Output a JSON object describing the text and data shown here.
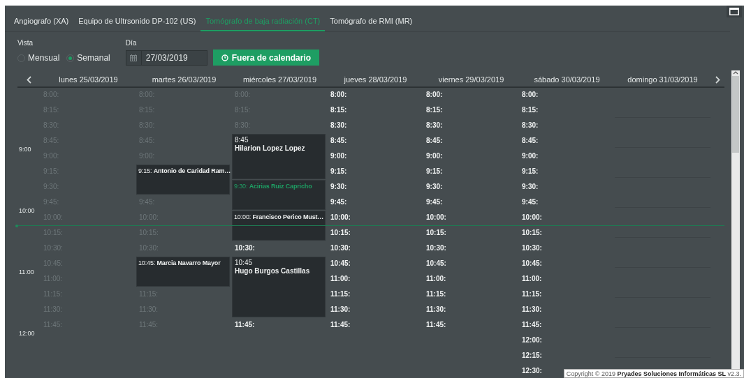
{
  "tabs": [
    {
      "label": "Angiografo (XA)",
      "selected": false
    },
    {
      "label": "Equipo de Ultrsonido DP-102 (US)",
      "selected": false
    },
    {
      "label": "Tomógrafo de baja radiación (CT)",
      "selected": true
    },
    {
      "label": "Tomógrafo de RMI (MR)",
      "selected": false
    }
  ],
  "view": {
    "label": "Vista",
    "options": [
      {
        "label": "Mensual",
        "selected": false
      },
      {
        "label": "Semanal",
        "selected": true
      }
    ]
  },
  "date": {
    "label": "Día",
    "value": "27/03/2019"
  },
  "out_of_calendar_button": {
    "label": "Fuera de calendario"
  },
  "hours": [
    "9:00",
    "10:00",
    "11:00",
    "12:00"
  ],
  "days": [
    {
      "header": "lunes 25/03/2019",
      "items": [
        {
          "kind": "slot",
          "time": "8:00:",
          "past": true
        },
        {
          "kind": "slot",
          "time": "8:15:",
          "past": true
        },
        {
          "kind": "slot",
          "time": "8:30:",
          "past": true
        },
        {
          "kind": "slot",
          "time": "8:45:",
          "past": true
        },
        {
          "kind": "slot",
          "time": "9:00:",
          "past": true
        },
        {
          "kind": "slot",
          "time": "9:15:",
          "past": true
        },
        {
          "kind": "slot",
          "time": "9:30:",
          "past": true
        },
        {
          "kind": "slot",
          "time": "9:45:",
          "past": true
        },
        {
          "kind": "slot",
          "time": "10:00:",
          "past": true
        },
        {
          "kind": "slot",
          "time": "10:15:",
          "past": true
        },
        {
          "kind": "slot",
          "time": "10:30:",
          "past": true
        },
        {
          "kind": "slot",
          "time": "10:45:",
          "past": true
        },
        {
          "kind": "slot",
          "time": "11:00:",
          "past": true
        },
        {
          "kind": "slot",
          "time": "11:15:",
          "past": true
        },
        {
          "kind": "slot",
          "time": "11:30:",
          "past": true
        },
        {
          "kind": "slot",
          "time": "11:45:",
          "past": true
        }
      ]
    },
    {
      "header": "martes 26/03/2019",
      "items": [
        {
          "kind": "slot",
          "time": "8:00:",
          "past": true
        },
        {
          "kind": "slot",
          "time": "8:15:",
          "past": true
        },
        {
          "kind": "slot",
          "time": "8:30:",
          "past": true
        },
        {
          "kind": "slot",
          "time": "8:45:",
          "past": true
        },
        {
          "kind": "slot",
          "time": "9:00:",
          "past": true
        },
        {
          "kind": "inline-event",
          "time": "9:15:",
          "name": "Antonio de Caridad Ram…",
          "highlighted": false
        },
        {
          "kind": "slot",
          "time": "9:45:",
          "past": true
        },
        {
          "kind": "slot",
          "time": "10:00:",
          "past": true
        },
        {
          "kind": "slot",
          "time": "10:15:",
          "past": true
        },
        {
          "kind": "slot",
          "time": "10:30:",
          "past": true
        },
        {
          "kind": "inline-event",
          "time": "10:45:",
          "name": "Marcia Navarro Mayor",
          "highlighted": false
        },
        {
          "kind": "slot",
          "time": "11:15:",
          "past": true
        },
        {
          "kind": "slot",
          "time": "11:30:",
          "past": true
        },
        {
          "kind": "slot",
          "time": "11:45:",
          "past": true
        }
      ]
    },
    {
      "header": "miércoles 27/03/2019",
      "items": [
        {
          "kind": "slot",
          "time": "8:00:",
          "past": true
        },
        {
          "kind": "slot",
          "time": "8:15:",
          "past": true
        },
        {
          "kind": "slot",
          "time": "8:30:",
          "past": true
        },
        {
          "kind": "stacked-event",
          "time": "8:45",
          "name": "Hilarion Lopez Lopez",
          "highlighted": false
        },
        {
          "kind": "inline-event",
          "time": "9:30:",
          "name": "Acirias Ruiz Capricho",
          "highlighted": true
        },
        {
          "kind": "inline-event",
          "time": "10:00:",
          "name": "Francisco Perico Must…",
          "highlighted": false
        },
        {
          "kind": "slot",
          "time": "10:30:",
          "past": false
        },
        {
          "kind": "stacked-event",
          "time": "10:45",
          "name": "Hugo Burgos Castillas",
          "highlighted": false
        },
        {
          "kind": "slot",
          "time": "11:45:",
          "past": false
        }
      ]
    },
    {
      "header": "jueves 28/03/2019",
      "items": [
        {
          "kind": "slot",
          "time": "8:00:",
          "past": false
        },
        {
          "kind": "slot",
          "time": "8:15:",
          "past": false
        },
        {
          "kind": "slot",
          "time": "8:30:",
          "past": false
        },
        {
          "kind": "slot",
          "time": "8:45:",
          "past": false
        },
        {
          "kind": "slot",
          "time": "9:00:",
          "past": false
        },
        {
          "kind": "slot",
          "time": "9:15:",
          "past": false
        },
        {
          "kind": "slot",
          "time": "9:30:",
          "past": false
        },
        {
          "kind": "slot",
          "time": "9:45:",
          "past": false
        },
        {
          "kind": "slot",
          "time": "10:00:",
          "past": false
        },
        {
          "kind": "slot",
          "time": "10:15:",
          "past": false
        },
        {
          "kind": "slot",
          "time": "10:30:",
          "past": false
        },
        {
          "kind": "slot",
          "time": "10:45:",
          "past": false
        },
        {
          "kind": "slot",
          "time": "11:00:",
          "past": false
        },
        {
          "kind": "slot",
          "time": "11:15:",
          "past": false
        },
        {
          "kind": "slot",
          "time": "11:30:",
          "past": false
        },
        {
          "kind": "slot",
          "time": "11:45:",
          "past": false
        }
      ]
    },
    {
      "header": "viernes 29/03/2019",
      "items": [
        {
          "kind": "slot",
          "time": "8:00:",
          "past": false
        },
        {
          "kind": "slot",
          "time": "8:15:",
          "past": false
        },
        {
          "kind": "slot",
          "time": "8:30:",
          "past": false
        },
        {
          "kind": "slot",
          "time": "8:45:",
          "past": false
        },
        {
          "kind": "slot",
          "time": "9:00:",
          "past": false
        },
        {
          "kind": "slot",
          "time": "9:15:",
          "past": false
        },
        {
          "kind": "slot",
          "time": "9:30:",
          "past": false
        },
        {
          "kind": "slot",
          "time": "9:45:",
          "past": false
        },
        {
          "kind": "slot",
          "time": "10:00:",
          "past": false
        },
        {
          "kind": "slot",
          "time": "10:15:",
          "past": false
        },
        {
          "kind": "slot",
          "time": "10:30:",
          "past": false
        },
        {
          "kind": "slot",
          "time": "10:45:",
          "past": false
        },
        {
          "kind": "slot",
          "time": "11:00:",
          "past": false
        },
        {
          "kind": "slot",
          "time": "11:15:",
          "past": false
        },
        {
          "kind": "slot",
          "time": "11:30:",
          "past": false
        },
        {
          "kind": "slot",
          "time": "11:45:",
          "past": false
        }
      ]
    },
    {
      "header": "sábado 30/03/2019",
      "items": [
        {
          "kind": "slot",
          "time": "8:00:",
          "past": false
        },
        {
          "kind": "slot",
          "time": "8:15:",
          "past": false
        },
        {
          "kind": "slot",
          "time": "8:30:",
          "past": false
        },
        {
          "kind": "slot",
          "time": "8:45:",
          "past": false
        },
        {
          "kind": "slot",
          "time": "9:00:",
          "past": false
        },
        {
          "kind": "slot",
          "time": "9:15:",
          "past": false
        },
        {
          "kind": "slot",
          "time": "9:30:",
          "past": false
        },
        {
          "kind": "slot",
          "time": "9:45:",
          "past": false
        },
        {
          "kind": "slot",
          "time": "10:00:",
          "past": false
        },
        {
          "kind": "slot",
          "time": "10:15:",
          "past": false
        },
        {
          "kind": "slot",
          "time": "10:30:",
          "past": false
        },
        {
          "kind": "slot",
          "time": "10:45:",
          "past": false
        },
        {
          "kind": "slot",
          "time": "11:00:",
          "past": false
        },
        {
          "kind": "slot",
          "time": "11:15:",
          "past": false
        },
        {
          "kind": "slot",
          "time": "11:30:",
          "past": false
        },
        {
          "kind": "slot",
          "time": "11:45:",
          "past": false
        },
        {
          "kind": "slot",
          "time": "12:00:",
          "past": false
        },
        {
          "kind": "slot",
          "time": "12:15:",
          "past": false
        },
        {
          "kind": "slot",
          "time": "12:30:",
          "past": false
        }
      ]
    },
    {
      "header": "domingo 31/03/2019"
    }
  ],
  "footer": "Copyright © 2019 **Pryades Soluciones Informáticas SL** v2.3."
}
